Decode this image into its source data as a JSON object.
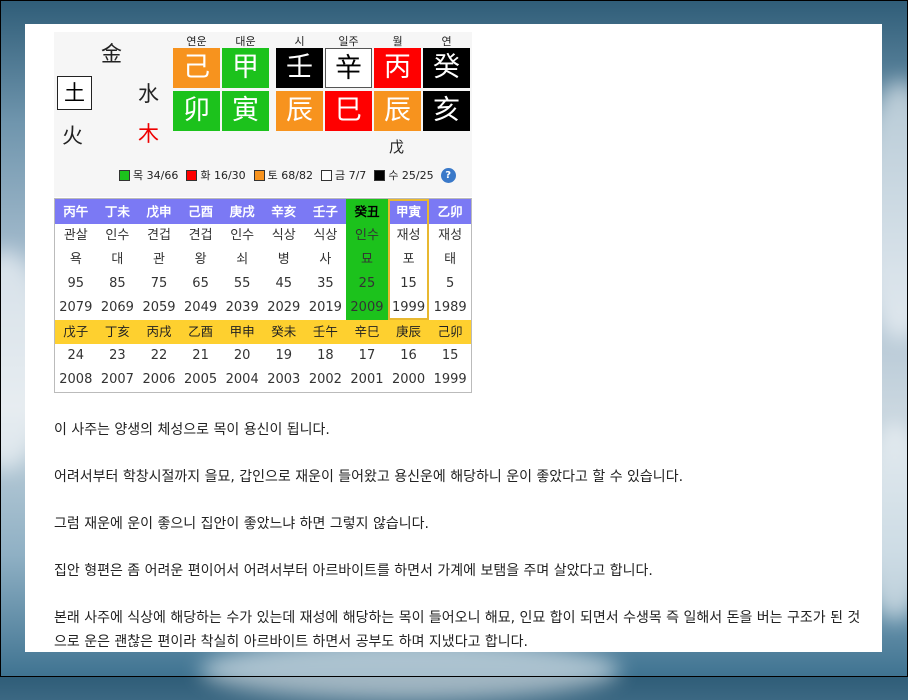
{
  "saju": {
    "elements": {
      "earth": "土",
      "fire": "火",
      "metal": "金",
      "water": "水",
      "wood": "木"
    },
    "columns": [
      {
        "header": "연운",
        "top": "己",
        "bottom": "卯"
      },
      {
        "header": "대운",
        "top": "甲",
        "bottom": "寅"
      },
      {
        "header": "시",
        "top": "壬",
        "bottom": "辰"
      },
      {
        "header": "일주",
        "top": "辛",
        "bottom": "巳"
      },
      {
        "header": "월",
        "top": "丙",
        "bottom": "辰"
      },
      {
        "header": "연",
        "top": "癸",
        "bottom": "亥"
      }
    ],
    "extra": "戊",
    "legend": [
      {
        "label": "목 34/66",
        "color": "#1cc21c"
      },
      {
        "label": "화 16/30",
        "color": "#ff0000"
      },
      {
        "label": "토 68/82",
        "color": "#f7931e"
      },
      {
        "label": "금 7/7",
        "color": "#ffffff"
      },
      {
        "label": "수 25/25",
        "color": "#000000"
      }
    ],
    "help_icon": "question-icon"
  },
  "daewoon": {
    "pillars": [
      "丙午",
      "丁未",
      "戊申",
      "己酉",
      "庚戌",
      "辛亥",
      "壬子",
      "癸丑",
      "甲寅",
      "乙卯"
    ],
    "sipsin": [
      "관살",
      "인수",
      "견겁",
      "견겁",
      "인수",
      "식상",
      "식상",
      "인수",
      "재성",
      "재성"
    ],
    "stage": [
      "욕",
      "대",
      "관",
      "왕",
      "쇠",
      "병",
      "사",
      "묘",
      "포",
      "태"
    ],
    "ages": [
      "95",
      "85",
      "75",
      "65",
      "55",
      "45",
      "35",
      "25",
      "15",
      "5"
    ],
    "years": [
      "2079",
      "2069",
      "2059",
      "2049",
      "2039",
      "2029",
      "2019",
      "2009",
      "1999",
      "1989"
    ]
  },
  "yeonwoon": {
    "pillars": [
      "戊子",
      "丁亥",
      "丙戌",
      "乙酉",
      "甲申",
      "癸未",
      "壬午",
      "辛巳",
      "庚辰",
      "己卯"
    ],
    "ages": [
      "24",
      "23",
      "22",
      "21",
      "20",
      "19",
      "18",
      "17",
      "16",
      "15"
    ],
    "years": [
      "2008",
      "2007",
      "2006",
      "2005",
      "2004",
      "2003",
      "2002",
      "2001",
      "2000",
      "1999"
    ]
  },
  "paragraphs": [
    "이 사주는 양생의 체성으로 목이 용신이 됩니다.",
    "어려서부터 학창시절까지 을묘, 갑인으로 재운이 들어왔고 용신운에 해당하니 운이 좋았다고 할 수 있습니다.",
    "그럼 재운에 운이 좋으니 집안이 좋았느냐 하면 그렇지 않습니다.",
    "집안 형편은 좀 어려운 편이어서 어려서부터 아르바이트를 하면서 가계에 보탬을 주며 살았다고 합니다.",
    "본래 사주에 식상에 해당하는 수가 있는데 재성에 해당하는 목이 들어오니 해묘, 인묘 합이 되면서 수생목 즉 일해서 돈을 버는 구조가 된 것으로 운은 괜찮은 편이라 착실히 아르바이트 하면서 공부도 하며 지냈다고 합니다."
  ]
}
